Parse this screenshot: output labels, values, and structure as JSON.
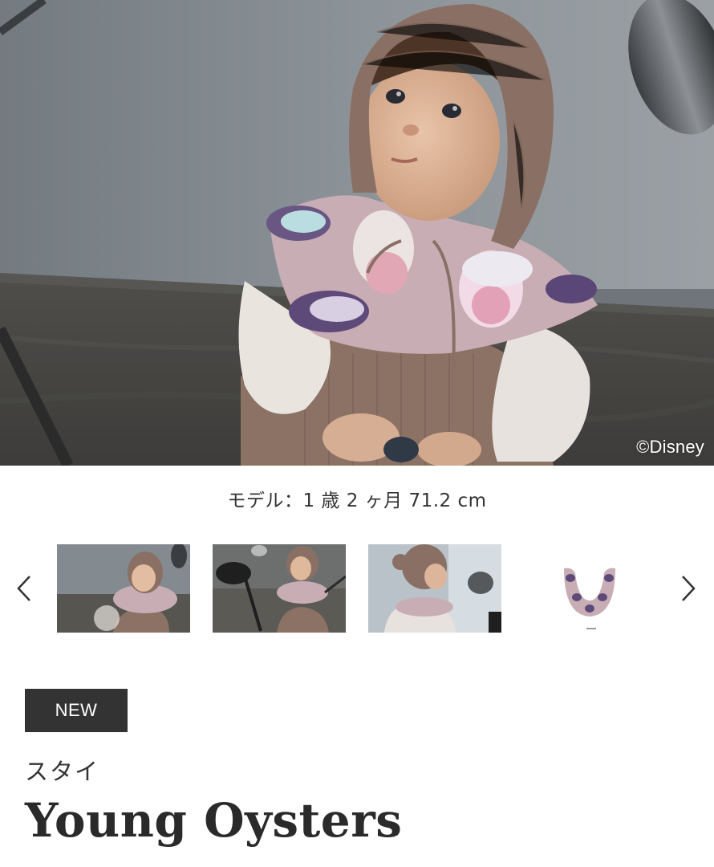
{
  "hero": {
    "credit": "©Disney",
    "image_label": "Baby wearing knit bonnet and Young Oysters bib"
  },
  "caption": "モデル：1 歳 2 ヶ月 71.2 cm",
  "carousel": {
    "prev_icon": "chevron-left-icon",
    "next_icon": "chevron-right-icon",
    "thumbnails": [
      {
        "label": "look-1"
      },
      {
        "label": "look-2"
      },
      {
        "label": "look-3"
      },
      {
        "label": "product-flat"
      }
    ]
  },
  "product": {
    "badge": "NEW",
    "category": "スタイ",
    "name": "Young Oysters"
  },
  "colors": {
    "badge_bg": "#333333",
    "text": "#222222",
    "knit": "#8a7064",
    "bib_lilac": "#c9adb5"
  }
}
